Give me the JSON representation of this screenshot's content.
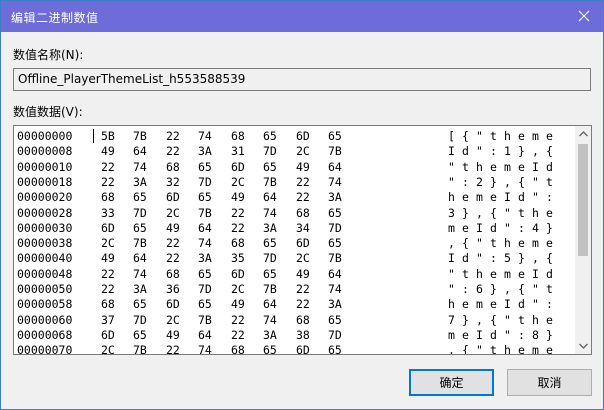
{
  "window": {
    "title": "编辑二进制数值"
  },
  "name": {
    "label": "数值名称(N):",
    "value": "Offline_PlayerThemeList_h553588539"
  },
  "data": {
    "label": "数值数据(V):",
    "rows": [
      {
        "offset": "00000000",
        "bytes": [
          "5B",
          "7B",
          "22",
          "74",
          "68",
          "65",
          "6D",
          "65"
        ],
        "ascii": [
          "[",
          "{",
          "\"",
          "t",
          "h",
          "e",
          "m",
          "e"
        ]
      },
      {
        "offset": "00000008",
        "bytes": [
          "49",
          "64",
          "22",
          "3A",
          "31",
          "7D",
          "2C",
          "7B"
        ],
        "ascii": [
          "I",
          "d",
          "\"",
          ":",
          "1",
          "}",
          ",",
          "{"
        ]
      },
      {
        "offset": "00000010",
        "bytes": [
          "22",
          "74",
          "68",
          "65",
          "6D",
          "65",
          "49",
          "64"
        ],
        "ascii": [
          "\"",
          "t",
          "h",
          "e",
          "m",
          "e",
          "I",
          "d"
        ]
      },
      {
        "offset": "00000018",
        "bytes": [
          "22",
          "3A",
          "32",
          "7D",
          "2C",
          "7B",
          "22",
          "74"
        ],
        "ascii": [
          "\"",
          ":",
          "2",
          "}",
          ",",
          "{",
          "\"",
          "t"
        ]
      },
      {
        "offset": "00000020",
        "bytes": [
          "68",
          "65",
          "6D",
          "65",
          "49",
          "64",
          "22",
          "3A"
        ],
        "ascii": [
          "h",
          "e",
          "m",
          "e",
          "I",
          "d",
          "\"",
          ":"
        ]
      },
      {
        "offset": "00000028",
        "bytes": [
          "33",
          "7D",
          "2C",
          "7B",
          "22",
          "74",
          "68",
          "65"
        ],
        "ascii": [
          "3",
          "}",
          ",",
          "{",
          "\"",
          "t",
          "h",
          "e"
        ]
      },
      {
        "offset": "00000030",
        "bytes": [
          "6D",
          "65",
          "49",
          "64",
          "22",
          "3A",
          "34",
          "7D"
        ],
        "ascii": [
          "m",
          "e",
          "I",
          "d",
          "\"",
          ":",
          "4",
          "}"
        ]
      },
      {
        "offset": "00000038",
        "bytes": [
          "2C",
          "7B",
          "22",
          "74",
          "68",
          "65",
          "6D",
          "65"
        ],
        "ascii": [
          ",",
          "{",
          "\"",
          "t",
          "h",
          "e",
          "m",
          "e"
        ]
      },
      {
        "offset": "00000040",
        "bytes": [
          "49",
          "64",
          "22",
          "3A",
          "35",
          "7D",
          "2C",
          "7B"
        ],
        "ascii": [
          "I",
          "d",
          "\"",
          ":",
          "5",
          "}",
          ",",
          "{"
        ]
      },
      {
        "offset": "00000048",
        "bytes": [
          "22",
          "74",
          "68",
          "65",
          "6D",
          "65",
          "49",
          "64"
        ],
        "ascii": [
          "\"",
          "t",
          "h",
          "e",
          "m",
          "e",
          "I",
          "d"
        ]
      },
      {
        "offset": "00000050",
        "bytes": [
          "22",
          "3A",
          "36",
          "7D",
          "2C",
          "7B",
          "22",
          "74"
        ],
        "ascii": [
          "\"",
          ":",
          "6",
          "}",
          ",",
          "{",
          "\"",
          "t"
        ]
      },
      {
        "offset": "00000058",
        "bytes": [
          "68",
          "65",
          "6D",
          "65",
          "49",
          "64",
          "22",
          "3A"
        ],
        "ascii": [
          "h",
          "e",
          "m",
          "e",
          "I",
          "d",
          "\"",
          ":"
        ]
      },
      {
        "offset": "00000060",
        "bytes": [
          "37",
          "7D",
          "2C",
          "7B",
          "22",
          "74",
          "68",
          "65"
        ],
        "ascii": [
          "7",
          "}",
          ",",
          "{",
          "\"",
          "t",
          "h",
          "e"
        ]
      },
      {
        "offset": "00000068",
        "bytes": [
          "6D",
          "65",
          "49",
          "64",
          "22",
          "3A",
          "38",
          "7D"
        ],
        "ascii": [
          "m",
          "e",
          "I",
          "d",
          "\"",
          ":",
          "8",
          "}"
        ]
      },
      {
        "offset": "00000070",
        "bytes": [
          "2C",
          "7B",
          "22",
          "74",
          "68",
          "65",
          "6D",
          "65"
        ],
        "ascii": [
          ",",
          "{",
          "\"",
          "t",
          "h",
          "e",
          "m",
          "e"
        ]
      }
    ]
  },
  "buttons": {
    "ok": "确定",
    "cancel": "取消"
  },
  "colors": {
    "titlebar": "#6e6cd9",
    "primary_border": "#0078d7"
  },
  "icons": {
    "close": "close-icon",
    "scroll_up": "chevron-up-icon",
    "scroll_down": "chevron-down-icon"
  }
}
